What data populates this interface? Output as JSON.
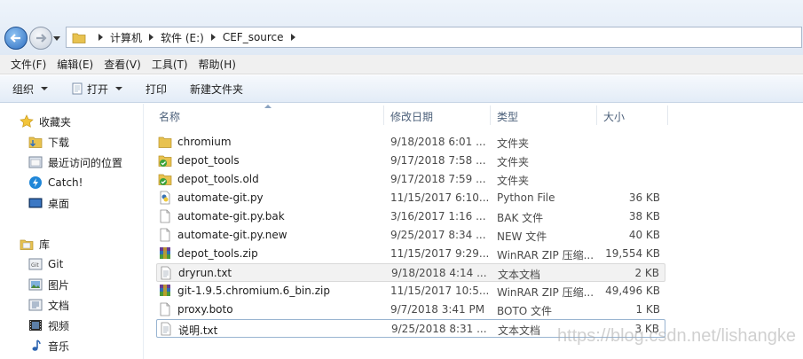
{
  "address": {
    "crumbs": [
      "计算机",
      "软件 (E:)",
      "CEF_source"
    ]
  },
  "menu": [
    "文件(F)",
    "编辑(E)",
    "查看(V)",
    "工具(T)",
    "帮助(H)"
  ],
  "toolbar": {
    "organize": "组织",
    "open": "打开",
    "print": "打印",
    "new_folder": "新建文件夹"
  },
  "nav": {
    "favorites": "收藏夹",
    "downloads": "下载",
    "recent": "最近访问的位置",
    "catch": "Catch!",
    "desktop": "桌面",
    "libraries": "库",
    "git": "Git",
    "pictures": "图片",
    "documents": "文档",
    "videos": "视频",
    "music": "音乐"
  },
  "columns": {
    "name": "名称",
    "date": "修改日期",
    "type": "类型",
    "size": "大小"
  },
  "files": [
    {
      "icon": "folder-icon",
      "name": "chromium",
      "date": "9/18/2018 6:01 ...",
      "type": "文件夹",
      "size": ""
    },
    {
      "icon": "folder-check-icon",
      "name": "depot_tools",
      "date": "9/17/2018 7:58 ...",
      "type": "文件夹",
      "size": ""
    },
    {
      "icon": "folder-check-icon",
      "name": "depot_tools.old",
      "date": "9/17/2018 7:59 ...",
      "type": "文件夹",
      "size": ""
    },
    {
      "icon": "python-file-icon",
      "name": "automate-git.py",
      "date": "11/15/2017 6:10...",
      "type": "Python File",
      "size": "36 KB"
    },
    {
      "icon": "blank-file-icon",
      "name": "automate-git.py.bak",
      "date": "3/16/2017 1:16 ...",
      "type": "BAK 文件",
      "size": "38 KB"
    },
    {
      "icon": "blank-file-icon",
      "name": "automate-git.py.new",
      "date": "9/25/2017 8:34 ...",
      "type": "NEW 文件",
      "size": "40 KB"
    },
    {
      "icon": "archive-icon",
      "name": "depot_tools.zip",
      "date": "11/15/2017 9:29...",
      "type": "WinRAR ZIP 压缩...",
      "size": "19,554 KB"
    },
    {
      "icon": "text-file-icon",
      "name": "dryrun.txt",
      "date": "9/18/2018 4:14 ...",
      "type": "文本文档",
      "size": "2 KB"
    },
    {
      "icon": "archive-icon",
      "name": "git-1.9.5.chromium.6_bin.zip",
      "date": "11/15/2017 10:5...",
      "type": "WinRAR ZIP 压缩...",
      "size": "49,496 KB"
    },
    {
      "icon": "blank-file-icon",
      "name": "proxy.boto",
      "date": "9/7/2018 3:41 PM",
      "type": "BOTO 文件",
      "size": "1 KB"
    },
    {
      "icon": "text-file-icon",
      "name": "说明.txt",
      "date": "9/25/2018 8:31 ...",
      "type": "文本文档",
      "size": "3 KB"
    }
  ],
  "watermark": "https://blog.csdn.net/lishangke"
}
